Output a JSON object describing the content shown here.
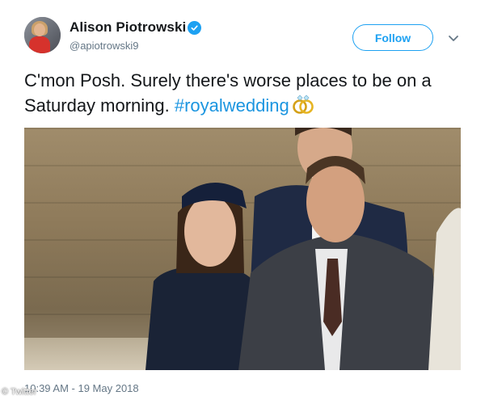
{
  "user": {
    "display_name": "Alison Piotrowski",
    "handle": "@apiotrowski9",
    "verified": true
  },
  "actions": {
    "follow_label": "Follow"
  },
  "tweet": {
    "text": "C'mon Posh. Surely there's worse places to be on a Saturday morning. ",
    "hashtag": "#royalwedding",
    "emoji": "rings-icon"
  },
  "meta": {
    "timestamp": "10:39 AM - 19 May 2018",
    "watermark": "© Twitter"
  },
  "colors": {
    "brand": "#1da1f2",
    "hashtag": "#1b95e0",
    "secondary_text": "#657786"
  }
}
